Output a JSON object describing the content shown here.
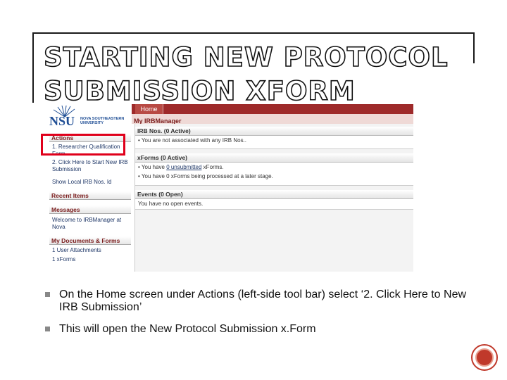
{
  "slide": {
    "title": "STARTING NEW PROTOCOL SUBMISSION XFORM",
    "bullets": [
      "On the Home screen under Actions (left-side tool bar) select ‘2. Click Here to New IRB Submission’",
      "This will open the New Protocol Submission x.Form"
    ]
  },
  "screenshot": {
    "home_tab": "Home",
    "banner": "My IRBManager",
    "logo": {
      "abbrev": "NSU",
      "name_line1": "NOVA SOUTHEASTERN",
      "name_line2": "UNIVERSITY"
    },
    "left": {
      "actions_header": "Actions",
      "actions": [
        "1. Researcher Qualification Form",
        "2. Click Here to Start New IRB Submission",
        "Show Local IRB Nos. Id"
      ],
      "recent_header": "Recent Items",
      "messages_header": "Messages",
      "message": "Welcome to IRBManager at Nova",
      "docs_header": "My Documents & Forms",
      "docs": [
        "1 User Attachments",
        "1 xForms"
      ]
    },
    "right": {
      "irb_header": "IRB Nos. (0 Active)",
      "irb_line": "You are not associated with any IRB Nos..",
      "xforms_header": "xForms (0 Active)",
      "xforms_line1_pre": "You have ",
      "xforms_line1_link": "0 unsubmitted",
      "xforms_line1_post": " xForms.",
      "xforms_line2": "You have 0 xForms being processed at a later stage.",
      "events_header": "Events (0 Open)",
      "events_line": "You have no open events."
    }
  },
  "colors": {
    "accent_red": "#9e2a2a",
    "highlight": "#e0001b",
    "nav_button": "#c0392b"
  }
}
